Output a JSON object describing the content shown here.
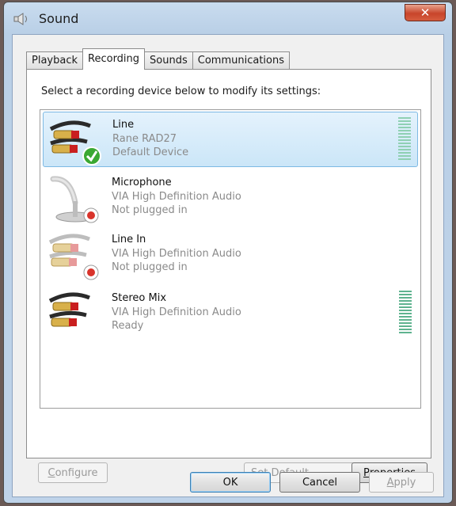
{
  "window": {
    "title": "Sound",
    "close_label": "✕"
  },
  "tabs": [
    {
      "label": "Playback",
      "active": false
    },
    {
      "label": "Recording",
      "active": true
    },
    {
      "label": "Sounds",
      "active": false
    },
    {
      "label": "Communications",
      "active": false
    }
  ],
  "recording": {
    "instruction": "Select a recording device below to modify its settings:",
    "devices": [
      {
        "name": "Line",
        "driver": "Rane RAD27",
        "status": "Default Device",
        "selected": true,
        "badge": "check"
      },
      {
        "name": "Microphone",
        "driver": "VIA High Definition Audio",
        "status": "Not plugged in",
        "selected": false,
        "badge": "unplugged"
      },
      {
        "name": "Line In",
        "driver": "VIA High Definition Audio",
        "status": "Not plugged in",
        "selected": false,
        "badge": "unplugged"
      },
      {
        "name": "Stereo Mix",
        "driver": "VIA High Definition Audio",
        "status": "Ready",
        "selected": false,
        "badge": "none"
      }
    ]
  },
  "buttons": {
    "configure": {
      "mnemonic": "C",
      "rest": "onfigure"
    },
    "set_default": {
      "mnemonic": "S",
      "rest": "et Default"
    },
    "properties": {
      "mnemonic": "P",
      "rest": "roperties"
    },
    "ok": "OK",
    "cancel": "Cancel",
    "apply": {
      "mnemonic": "A",
      "rest": "pply"
    }
  },
  "colors": {
    "selection": "#cbe6f8",
    "check_badge": "#3aa832",
    "unplugged_badge": "#d9342b",
    "meter": "#5fb38f"
  }
}
